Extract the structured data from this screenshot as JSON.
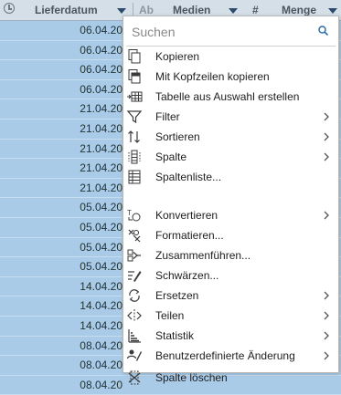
{
  "grid": {
    "columns": [
      {
        "label": "Lieferdatum"
      },
      {
        "label": "Ab"
      },
      {
        "label": "Medien"
      },
      {
        "label": "#"
      },
      {
        "label": "Menge"
      }
    ],
    "dates": [
      "06.04.20",
      "06.04.20",
      "06.04.20",
      "06.04.20",
      "21.04.20",
      "21.04.20",
      "21.04.20",
      "21.04.20",
      "21.04.20",
      "05.04.20",
      "05.04.20",
      "05.04.20",
      "05.04.20",
      "14.04.20",
      "14.04.20",
      "14.04.20",
      "08.04.20",
      "08.04.20",
      "08.04.20"
    ]
  },
  "menu": {
    "search": {
      "placeholder": "Suchen",
      "value": ""
    },
    "items": [
      {
        "label": "Kopieren",
        "icon": "copy-icon",
        "submenu": false
      },
      {
        "label": "Mit Kopfzeilen kopieren",
        "icon": "copy-with-headers-icon",
        "submenu": false
      },
      {
        "label": "Tabelle aus Auswahl erstellen",
        "icon": "create-table-icon",
        "submenu": false
      },
      {
        "label": "Filter",
        "icon": "filter-icon",
        "submenu": true
      },
      {
        "label": "Sortieren",
        "icon": "sort-icon",
        "submenu": true
      },
      {
        "label": "Spalte",
        "icon": "column-icon",
        "submenu": true
      },
      {
        "label": "Spaltenliste...",
        "icon": "column-list-icon",
        "submenu": false
      },
      {
        "label": "Konvertieren",
        "icon": "convert-icon",
        "submenu": true
      },
      {
        "label": "Formatieren...",
        "icon": "format-icon",
        "submenu": false
      },
      {
        "label": "Zusammenführen...",
        "icon": "merge-icon",
        "submenu": false
      },
      {
        "label": "Schwärzen...",
        "icon": "redact-icon",
        "submenu": false
      },
      {
        "label": "Ersetzen",
        "icon": "replace-icon",
        "submenu": true
      },
      {
        "label": "Teilen",
        "icon": "split-icon",
        "submenu": true
      },
      {
        "label": "Statistik",
        "icon": "statistics-icon",
        "submenu": true
      },
      {
        "label": "Benutzerdefinierte Änderung",
        "icon": "custom-change-icon",
        "submenu": true
      },
      {
        "label": "Spalte löschen",
        "icon": "delete-column-icon",
        "submenu": false
      }
    ]
  },
  "colors": {
    "selection": "#a9cbe8",
    "header": "#d4dfe8",
    "icon_dark": "#3a3a3a",
    "icon_blue": "#2b6fb3"
  }
}
